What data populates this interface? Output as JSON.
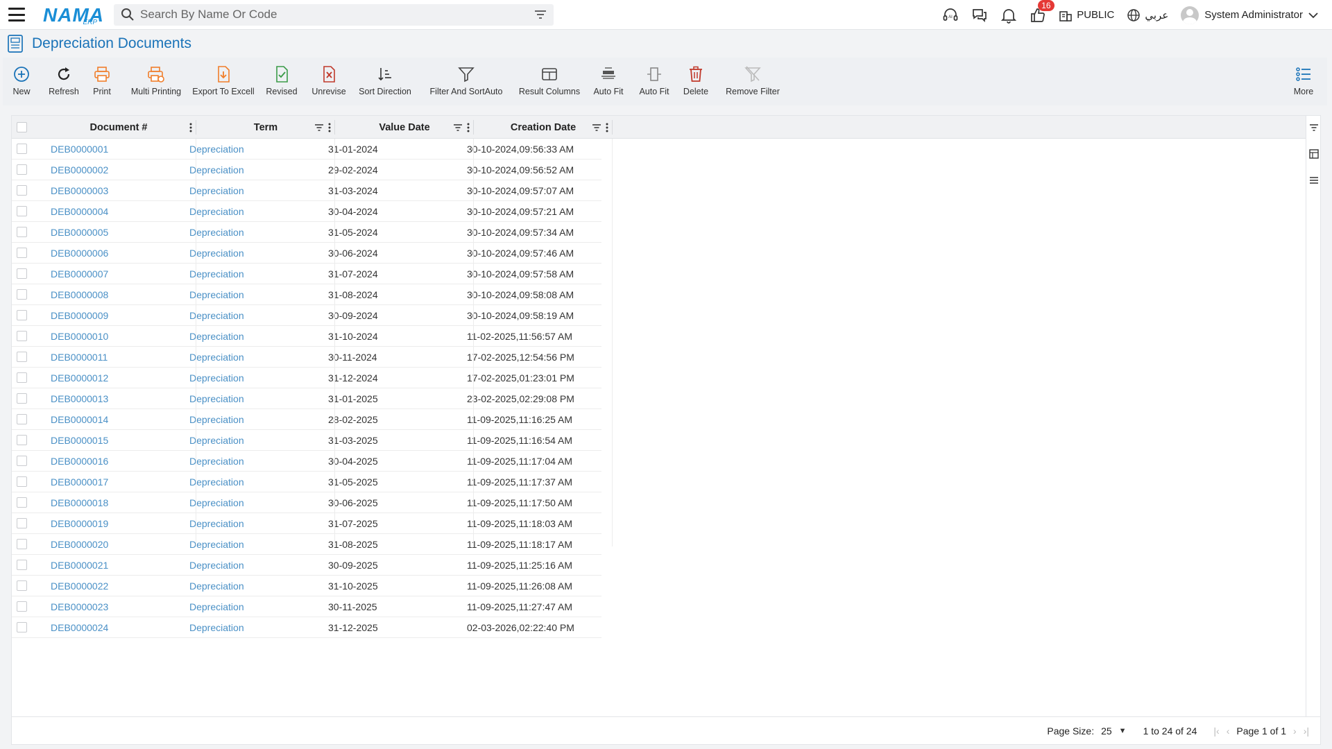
{
  "header": {
    "logo_main": "NAMA",
    "logo_sub": "ERP",
    "search_placeholder": "Search By Name Or Code",
    "badge_count": "16",
    "company": "PUBLIC",
    "language": "عربي",
    "user": "System Administrator"
  },
  "page": {
    "title": "Depreciation Documents"
  },
  "toolbar": {
    "new": "New",
    "refresh": "Refresh",
    "print": "Print",
    "multi_printing": "Multi Printing",
    "export": "Export To Excell",
    "revised": "Revised",
    "unrevise": "Unrevise",
    "sort_direction": "Sort Direction",
    "filter_sort": "Filter And SortAuto",
    "result_columns": "Result Columns",
    "auto_fit1": "Auto Fit",
    "auto_fit2": "Auto Fit",
    "delete": "Delete",
    "remove_filter": "Remove Filter",
    "more": "More"
  },
  "grid": {
    "columns": [
      "Document #",
      "Term",
      "Value Date",
      "Creation Date"
    ],
    "rows": [
      {
        "doc": "DEB0000001",
        "term": "Depreciation",
        "value_date": "31-01-2024",
        "created": "30-10-2024,09:56:33 AM"
      },
      {
        "doc": "DEB0000002",
        "term": "Depreciation",
        "value_date": "29-02-2024",
        "created": "30-10-2024,09:56:52 AM"
      },
      {
        "doc": "DEB0000003",
        "term": "Depreciation",
        "value_date": "31-03-2024",
        "created": "30-10-2024,09:57:07 AM"
      },
      {
        "doc": "DEB0000004",
        "term": "Depreciation",
        "value_date": "30-04-2024",
        "created": "30-10-2024,09:57:21 AM"
      },
      {
        "doc": "DEB0000005",
        "term": "Depreciation",
        "value_date": "31-05-2024",
        "created": "30-10-2024,09:57:34 AM"
      },
      {
        "doc": "DEB0000006",
        "term": "Depreciation",
        "value_date": "30-06-2024",
        "created": "30-10-2024,09:57:46 AM"
      },
      {
        "doc": "DEB0000007",
        "term": "Depreciation",
        "value_date": "31-07-2024",
        "created": "30-10-2024,09:57:58 AM"
      },
      {
        "doc": "DEB0000008",
        "term": "Depreciation",
        "value_date": "31-08-2024",
        "created": "30-10-2024,09:58:08 AM"
      },
      {
        "doc": "DEB0000009",
        "term": "Depreciation",
        "value_date": "30-09-2024",
        "created": "30-10-2024,09:58:19 AM"
      },
      {
        "doc": "DEB0000010",
        "term": "Depreciation",
        "value_date": "31-10-2024",
        "created": "11-02-2025,11:56:57 AM"
      },
      {
        "doc": "DEB0000011",
        "term": "Depreciation",
        "value_date": "30-11-2024",
        "created": "17-02-2025,12:54:56 PM"
      },
      {
        "doc": "DEB0000012",
        "term": "Depreciation",
        "value_date": "31-12-2024",
        "created": "17-02-2025,01:23:01 PM"
      },
      {
        "doc": "DEB0000013",
        "term": "Depreciation",
        "value_date": "31-01-2025",
        "created": "23-02-2025,02:29:08 PM"
      },
      {
        "doc": "DEB0000014",
        "term": "Depreciation",
        "value_date": "28-02-2025",
        "created": "11-09-2025,11:16:25 AM"
      },
      {
        "doc": "DEB0000015",
        "term": "Depreciation",
        "value_date": "31-03-2025",
        "created": "11-09-2025,11:16:54 AM"
      },
      {
        "doc": "DEB0000016",
        "term": "Depreciation",
        "value_date": "30-04-2025",
        "created": "11-09-2025,11:17:04 AM"
      },
      {
        "doc": "DEB0000017",
        "term": "Depreciation",
        "value_date": "31-05-2025",
        "created": "11-09-2025,11:17:37 AM"
      },
      {
        "doc": "DEB0000018",
        "term": "Depreciation",
        "value_date": "30-06-2025",
        "created": "11-09-2025,11:17:50 AM"
      },
      {
        "doc": "DEB0000019",
        "term": "Depreciation",
        "value_date": "31-07-2025",
        "created": "11-09-2025,11:18:03 AM"
      },
      {
        "doc": "DEB0000020",
        "term": "Depreciation",
        "value_date": "31-08-2025",
        "created": "11-09-2025,11:18:17 AM"
      },
      {
        "doc": "DEB0000021",
        "term": "Depreciation",
        "value_date": "30-09-2025",
        "created": "11-09-2025,11:25:16 AM"
      },
      {
        "doc": "DEB0000022",
        "term": "Depreciation",
        "value_date": "31-10-2025",
        "created": "11-09-2025,11:26:08 AM"
      },
      {
        "doc": "DEB0000023",
        "term": "Depreciation",
        "value_date": "30-11-2025",
        "created": "11-09-2025,11:27:47 AM"
      },
      {
        "doc": "DEB0000024",
        "term": "Depreciation",
        "value_date": "31-12-2025",
        "created": "02-03-2026,02:22:40 PM"
      }
    ]
  },
  "footer": {
    "page_size_label": "Page Size:",
    "page_size": "25",
    "range": "1 to 24 of 24",
    "page_info": "Page 1 of 1"
  },
  "colors": {
    "accent": "#1a73b8",
    "link": "#4a90c6",
    "orange": "#f07e2a",
    "green": "#3a9b48",
    "red": "#c0392b"
  }
}
